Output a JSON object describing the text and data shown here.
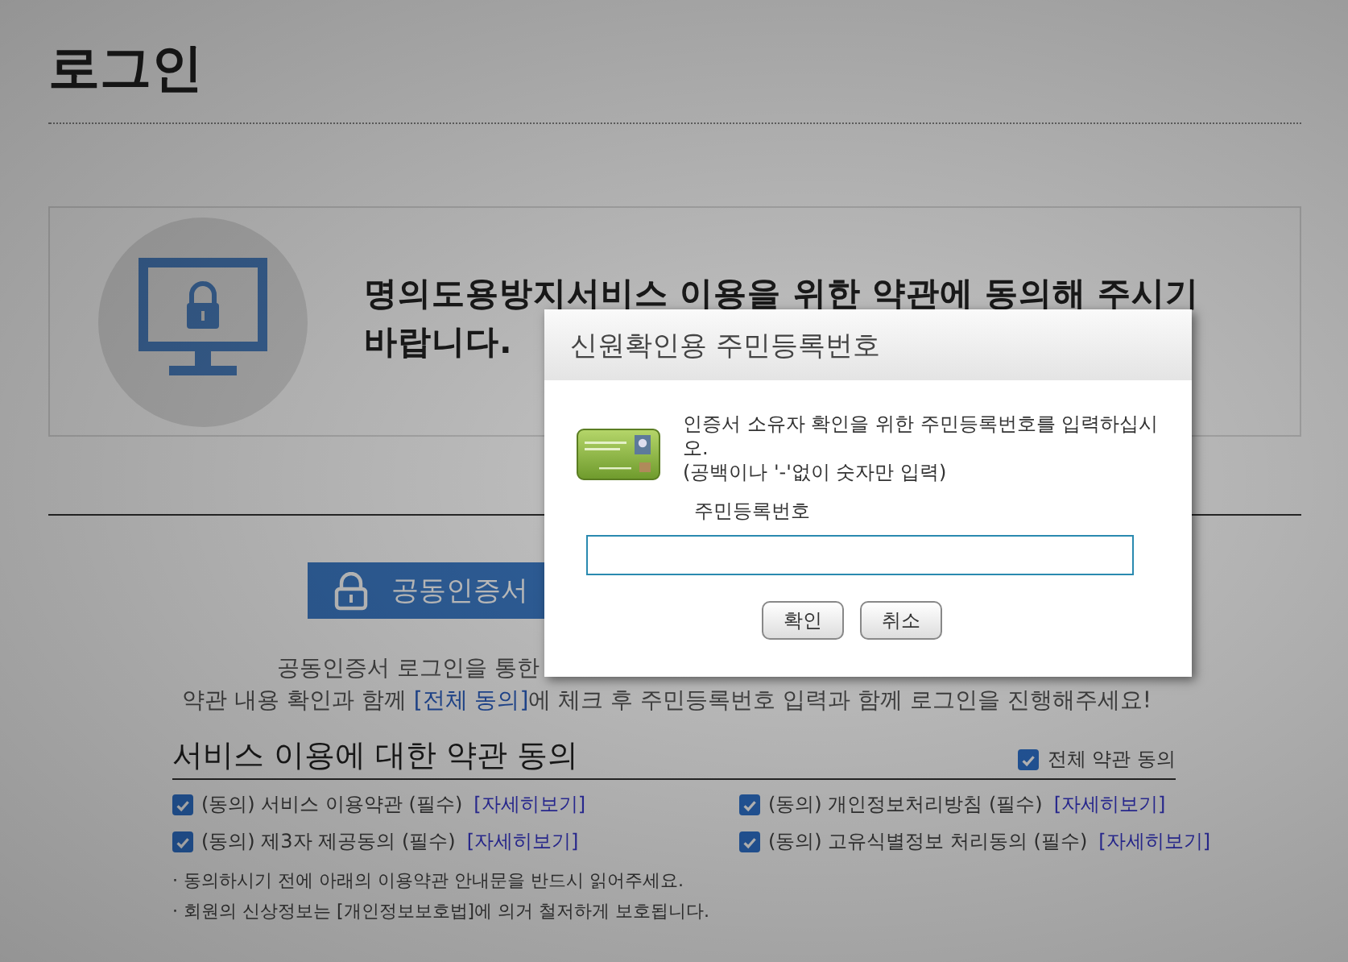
{
  "page": {
    "title": "로그인",
    "notice": {
      "line_1": "명의도용방지서비스 이용을 위한 약관에 동의해 주시기",
      "line_2": "바랍니다."
    },
    "login_button": "공동인증서",
    "intro": {
      "line_1": "공동인증서 로그인을 통한",
      "line_2_before": "약관 내용 확인과 함께 ",
      "line_2_link": "[전체 동의]",
      "line_2_after": "에 체크 후 주민등록번호 입력과 함께 로그인을 진행해주세요!"
    },
    "terms": {
      "heading": "서비스 이용에 대한 약관 동의",
      "all_agree": {
        "label": "전체 약관 동의",
        "checked": true
      },
      "items": [
        {
          "label": "(동의) 서비스 이용약관 (필수)",
          "link": "[자세히보기]",
          "checked": true
        },
        {
          "label": "(동의) 개인정보처리방침 (필수)",
          "link": "[자세히보기]",
          "checked": true
        },
        {
          "label": "(동의) 제3자 제공동의 (필수)",
          "link": "[자세히보기]",
          "checked": true
        },
        {
          "label": "(동의) 고유식별정보 처리동의 (필수)",
          "link": "[자세히보기]",
          "checked": true
        }
      ],
      "notes": [
        "· 동의하시기 전에 아래의 이용약관 안내문을 반드시 읽어주세요.",
        "· 회원의 신상정보는 [개인정보보호법]에 의거 철저하게 보호됩니다."
      ]
    }
  },
  "dialog": {
    "title": "신원확인용 주민등록번호",
    "message": "인증서 소유자 확인을 위한 주민등록번호를 입력하십시오.",
    "hint": "(공백이나 '-'없이 숫자만 입력)",
    "field_label": "주민등록번호",
    "buttons": [
      "확인",
      "취소"
    ]
  }
}
